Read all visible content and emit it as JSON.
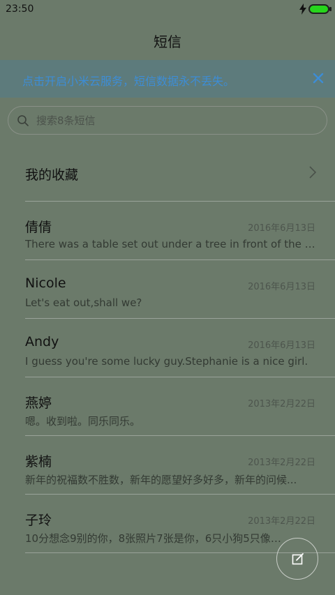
{
  "status_bar": {
    "time": "23:50",
    "battery_color": "#27d51c"
  },
  "header": {
    "title": "短信"
  },
  "banner": {
    "text": "点击开启小米云服务，短信数据永不丢失。",
    "close_icon": "close-icon",
    "text_color": "#3d8dd6"
  },
  "search": {
    "placeholder": "搜索8条短信",
    "value": "",
    "icon": "search-icon"
  },
  "favorites": {
    "label": "我的收藏",
    "icon": "chevron-right-icon"
  },
  "conversations": [
    {
      "name": "倩倩",
      "date": "2016年6月13日",
      "preview": "There was a table set out under a tree in front of the ho..."
    },
    {
      "name": "Nicole",
      "date": "2016年6月13日",
      "preview": "Let's eat out,shall we?"
    },
    {
      "name": "Andy",
      "date": "2016年6月13日",
      "preview": "I guess you're some lucky guy.Stephanie is a nice girl."
    },
    {
      "name": "燕婷",
      "date": "2013年2月22日",
      "preview": "嗯。收到啦。同乐同乐。"
    },
    {
      "name": "紫楠",
      "date": "2013年2月22日",
      "preview": "新年的祝福数不胜数，新年的愿望好多好多，新年的问候..."
    },
    {
      "name": "子玲",
      "date": "2013年2月22日",
      "preview": "10分想念9别的你，8张照片7张是你，6只小狗5只像你，4..."
    }
  ],
  "compose_button": {
    "icon": "compose-icon"
  }
}
